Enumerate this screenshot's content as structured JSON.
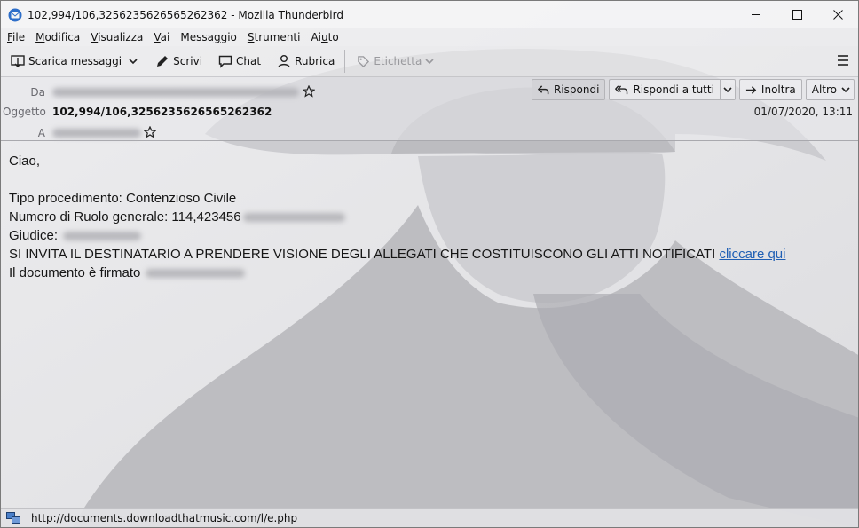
{
  "window": {
    "title": "102,994/106,3256235626565262362 - Mozilla Thunderbird",
    "minimize_glyph": "—",
    "maximize_glyph": "☐",
    "close_glyph": "✕"
  },
  "menu": {
    "items": [
      {
        "pre": "",
        "u": "F",
        "post": "ile"
      },
      {
        "pre": "",
        "u": "M",
        "post": "odifica"
      },
      {
        "pre": "",
        "u": "V",
        "post": "isualizza"
      },
      {
        "pre": "",
        "u": "V",
        "post": "ai"
      },
      {
        "pre": "Messa",
        "u": "g",
        "post": "gio"
      },
      {
        "pre": "",
        "u": "S",
        "post": "trumenti"
      },
      {
        "pre": "Ai",
        "u": "u",
        "post": "to"
      }
    ]
  },
  "toolbar": {
    "get_messages": "Scarica messaggi",
    "write": "Scrivi",
    "chat": "Chat",
    "address_book": "Rubrica",
    "tag": "Etichetta"
  },
  "header": {
    "from_label": "Da",
    "subject_label": "Oggetto",
    "to_label": "A",
    "subject": "102,994/106,3256235626565262362",
    "date": "01/07/2020, 13:11",
    "reply": "Rispondi",
    "reply_all": "Rispondi a tutti",
    "forward": "Inoltra",
    "more": "Altro"
  },
  "body": {
    "greeting": "Ciao,",
    "line_procedure": "Tipo procedimento: Contenzioso Civile",
    "line_number": "Numero di Ruolo generale: 114,423456",
    "line_judge": "Giudice:",
    "line_invite": "SI INVITA IL DESTINATARIO A PRENDERE VISIONE DEGLI ALLEGATI CHE COSTITUISCONO GLI ATTI NOTIFICATI",
    "link_text": "cliccare qui",
    "line_signed": "Il documento è firmato"
  },
  "status": {
    "url": "http://documents.downloadthatmusic.com/l/e.php"
  },
  "colors": {
    "link": "#1f5fb4",
    "header_text": "#6a6a70"
  }
}
